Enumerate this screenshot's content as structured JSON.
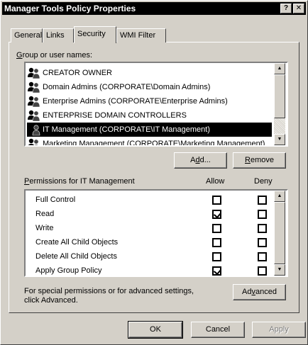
{
  "window": {
    "title": "Manager Tools Policy Properties",
    "help_glyph": "?",
    "close_glyph": "✕"
  },
  "tabs": [
    {
      "label": "General",
      "active": false
    },
    {
      "label": "Links",
      "active": false
    },
    {
      "label": "Security",
      "active": true
    },
    {
      "label": "WMI Filter",
      "active": false
    }
  ],
  "groups": {
    "label_prefix": "G",
    "label_rest": "roup or user names:",
    "items": [
      {
        "label": "CREATOR OWNER",
        "icon": "group-users-icon",
        "selected": false
      },
      {
        "label": "Domain Admins (CORPORATE\\Domain Admins)",
        "icon": "group-users-icon",
        "selected": false
      },
      {
        "label": "Enterprise Admins (CORPORATE\\Enterprise Admins)",
        "icon": "group-users-icon",
        "selected": false
      },
      {
        "label": "ENTERPRISE DOMAIN CONTROLLERS",
        "icon": "group-users-icon",
        "selected": false
      },
      {
        "label": "IT Management (CORPORATE\\IT Management)",
        "icon": "group-users-icon",
        "selected": true
      },
      {
        "label": "Marketing Management (CORPORATE\\Marketing Management)",
        "icon": "group-users-icon",
        "selected": false
      }
    ]
  },
  "buttons": {
    "add_pre": "A",
    "add_ul": "d",
    "add_post": "d...",
    "remove_ul": "R",
    "remove_post": "emove",
    "advanced_pre": "Ad",
    "advanced_ul": "v",
    "advanced_post": "anced",
    "ok": "OK",
    "cancel": "Cancel",
    "apply": "Apply"
  },
  "permissions": {
    "label_ul": "P",
    "label_rest": "ermissions for IT Management",
    "allow_header": "Allow",
    "deny_header": "Deny",
    "rows": [
      {
        "label": "Full Control",
        "allow": false,
        "deny": false
      },
      {
        "label": "Read",
        "allow": true,
        "deny": false
      },
      {
        "label": "Write",
        "allow": false,
        "deny": false
      },
      {
        "label": "Create All Child Objects",
        "allow": false,
        "deny": false
      },
      {
        "label": "Delete All Child Objects",
        "allow": false,
        "deny": false
      },
      {
        "label": "Apply Group Policy",
        "allow": true,
        "deny": false
      }
    ]
  },
  "special_note_line1": "For special permissions or for advanced settings,",
  "special_note_line2": "click Advanced."
}
